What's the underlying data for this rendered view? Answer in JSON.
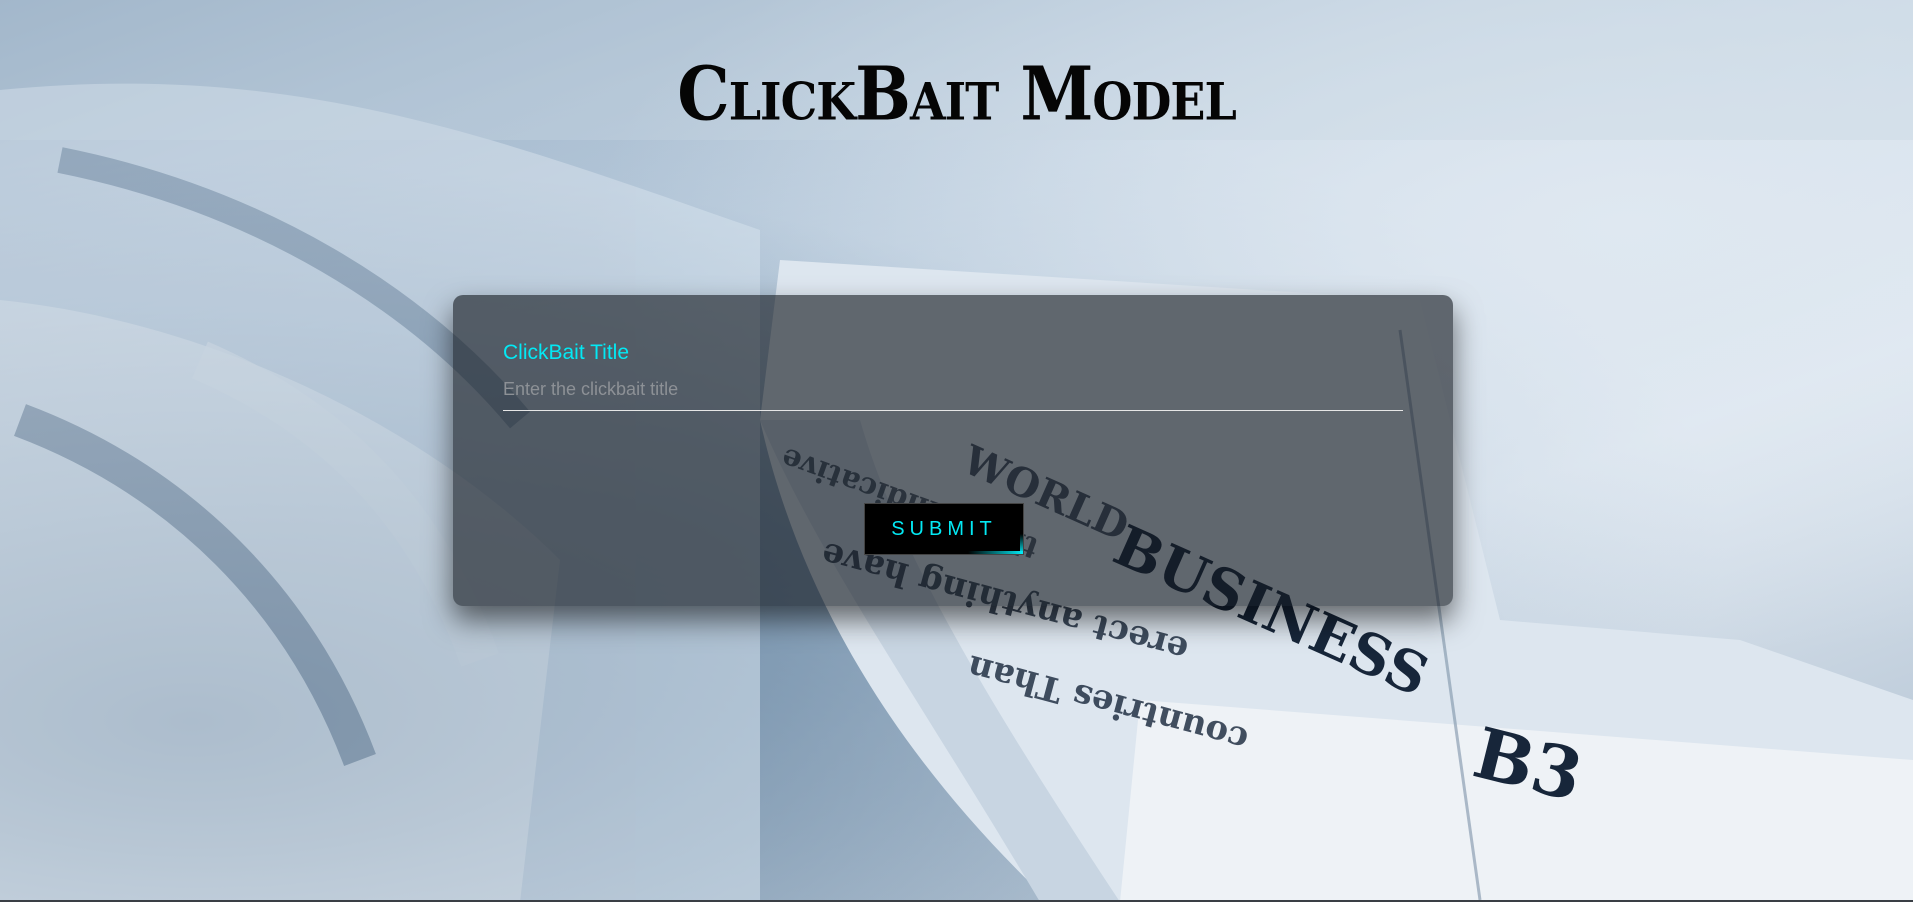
{
  "page": {
    "title": "ClickBait Model"
  },
  "form": {
    "label": "ClickBait Title",
    "input_placeholder": "Enter the clickbait title",
    "input_value": "",
    "submit_label": "SUBMIT"
  },
  "background": {
    "description_words": [
      "WORLD",
      "BUSINESS",
      "B3"
    ]
  },
  "colors": {
    "accent": "#03e9f4",
    "card": "#14181e",
    "button": "#000000",
    "title": "#050505"
  }
}
